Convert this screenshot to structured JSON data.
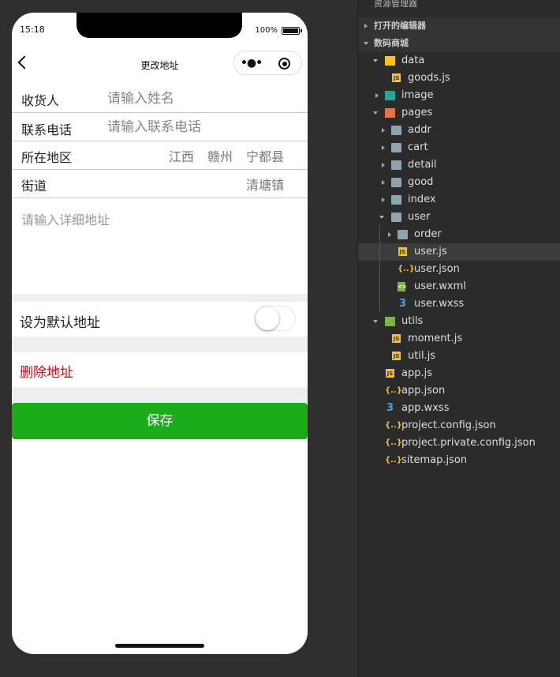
{
  "phone": {
    "time": "15:18",
    "battery": "100%",
    "nav_title": "更改地址",
    "more_icon": "•●•",
    "form": {
      "name_label": "收货人",
      "name_placeholder": "请输入姓名",
      "phone_label": "联系电话",
      "phone_placeholder": "请输入联系电话",
      "region_label": "所在地区",
      "region_value": "江西 赣州 宁都县",
      "street_label": "街道",
      "street_value": "清塘镇",
      "detail_placeholder": "请输入详细地址"
    },
    "default_label": "设为默认地址",
    "default_on": false,
    "delete_label": "删除地址",
    "save_label": "保存"
  },
  "colors": {
    "save": "#1aad19",
    "delete": "#e60012"
  },
  "sidebar": {
    "title": "资源管理器",
    "open_editors": "打开的编辑器",
    "project": "数码商城",
    "tree": [
      {
        "label": "data",
        "level": 1,
        "icon": "fdata",
        "arrow": "d"
      },
      {
        "label": "goods.js",
        "level": 2,
        "icon": "js"
      },
      {
        "label": "image",
        "level": 1,
        "icon": "fimage",
        "arrow": "r"
      },
      {
        "label": "pages",
        "level": 1,
        "icon": "fpages",
        "arrow": "d"
      },
      {
        "label": "addr",
        "level": 2,
        "icon": "folder",
        "arrow": "r"
      },
      {
        "label": "cart",
        "level": 2,
        "icon": "folder",
        "arrow": "r"
      },
      {
        "label": "detail",
        "level": 2,
        "icon": "folder",
        "arrow": "r"
      },
      {
        "label": "good",
        "level": 2,
        "icon": "folder",
        "arrow": "r"
      },
      {
        "label": "index",
        "level": 2,
        "icon": "folder",
        "arrow": "r"
      },
      {
        "label": "user",
        "level": 2,
        "icon": "folder",
        "arrow": "d"
      },
      {
        "label": "order",
        "level": 3,
        "icon": "folder",
        "arrow": "r"
      },
      {
        "label": "user.js",
        "level": 3,
        "icon": "js",
        "selected": true
      },
      {
        "label": "user.json",
        "level": 3,
        "icon": "json"
      },
      {
        "label": "user.wxml",
        "level": 3,
        "icon": "wxml"
      },
      {
        "label": "user.wxss",
        "level": 3,
        "icon": "wxss"
      },
      {
        "label": "utils",
        "level": 1,
        "icon": "futils",
        "arrow": "d"
      },
      {
        "label": "moment.js",
        "level": 2,
        "icon": "js"
      },
      {
        "label": "util.js",
        "level": 2,
        "icon": "js"
      },
      {
        "label": "app.js",
        "level": 1,
        "icon": "js"
      },
      {
        "label": "app.json",
        "level": 1,
        "icon": "json"
      },
      {
        "label": "app.wxss",
        "level": 1,
        "icon": "wxss"
      },
      {
        "label": "project.config.json",
        "level": 1,
        "icon": "json"
      },
      {
        "label": "project.private.config.json",
        "level": 1,
        "icon": "json"
      },
      {
        "label": "sitemap.json",
        "level": 1,
        "icon": "json"
      }
    ]
  }
}
